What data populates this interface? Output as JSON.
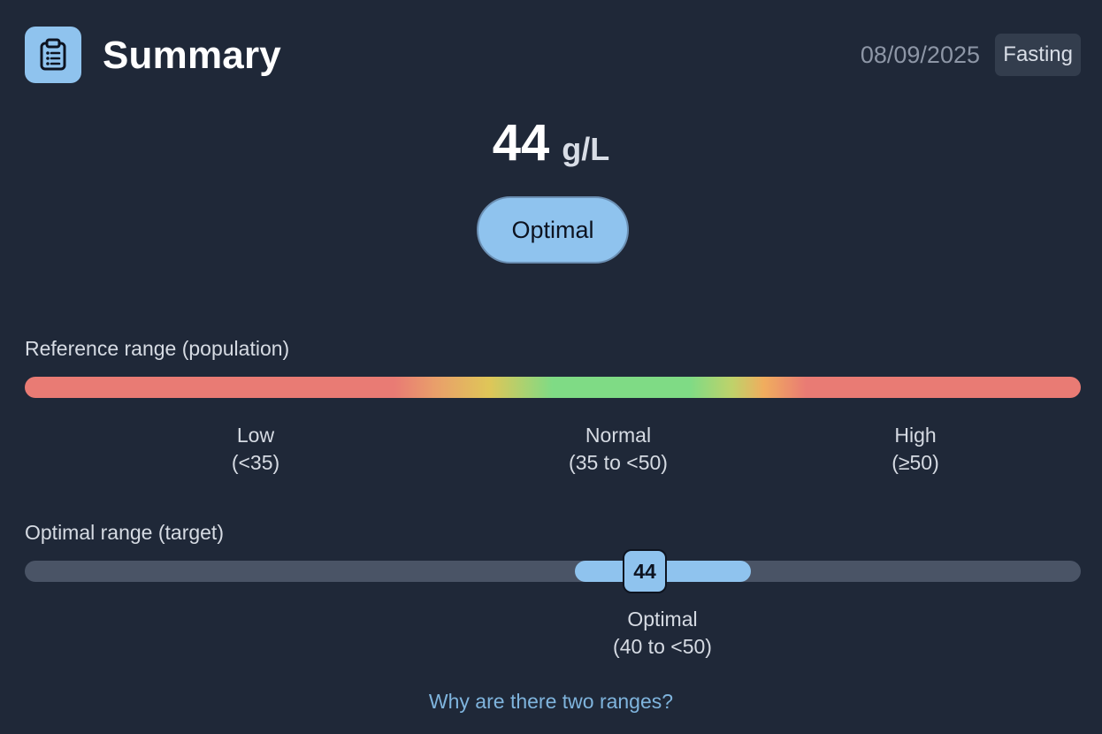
{
  "header": {
    "title": "Summary",
    "icon": "clipboard-icon",
    "date": "08/09/2025",
    "badge": "Fasting"
  },
  "result": {
    "value": "44",
    "unit": "g/L",
    "status": "Optimal"
  },
  "reference_range": {
    "label": "Reference range (population)",
    "segments": [
      {
        "name": "Low",
        "range": "(<35)"
      },
      {
        "name": "Normal",
        "range": "(35 to <50)"
      },
      {
        "name": "High",
        "range": "(≥50)"
      }
    ]
  },
  "optimal_range": {
    "label": "Optimal range (target)",
    "marker_value": "44",
    "name": "Optimal",
    "range": "(40 to <50)"
  },
  "help_link": "Why are there two ranges?",
  "colors": {
    "background": "#1f2838",
    "accent": "#8fc3ee",
    "low_high": "#e97b74",
    "normal": "#7fdb85",
    "link": "#7fb4dd"
  }
}
